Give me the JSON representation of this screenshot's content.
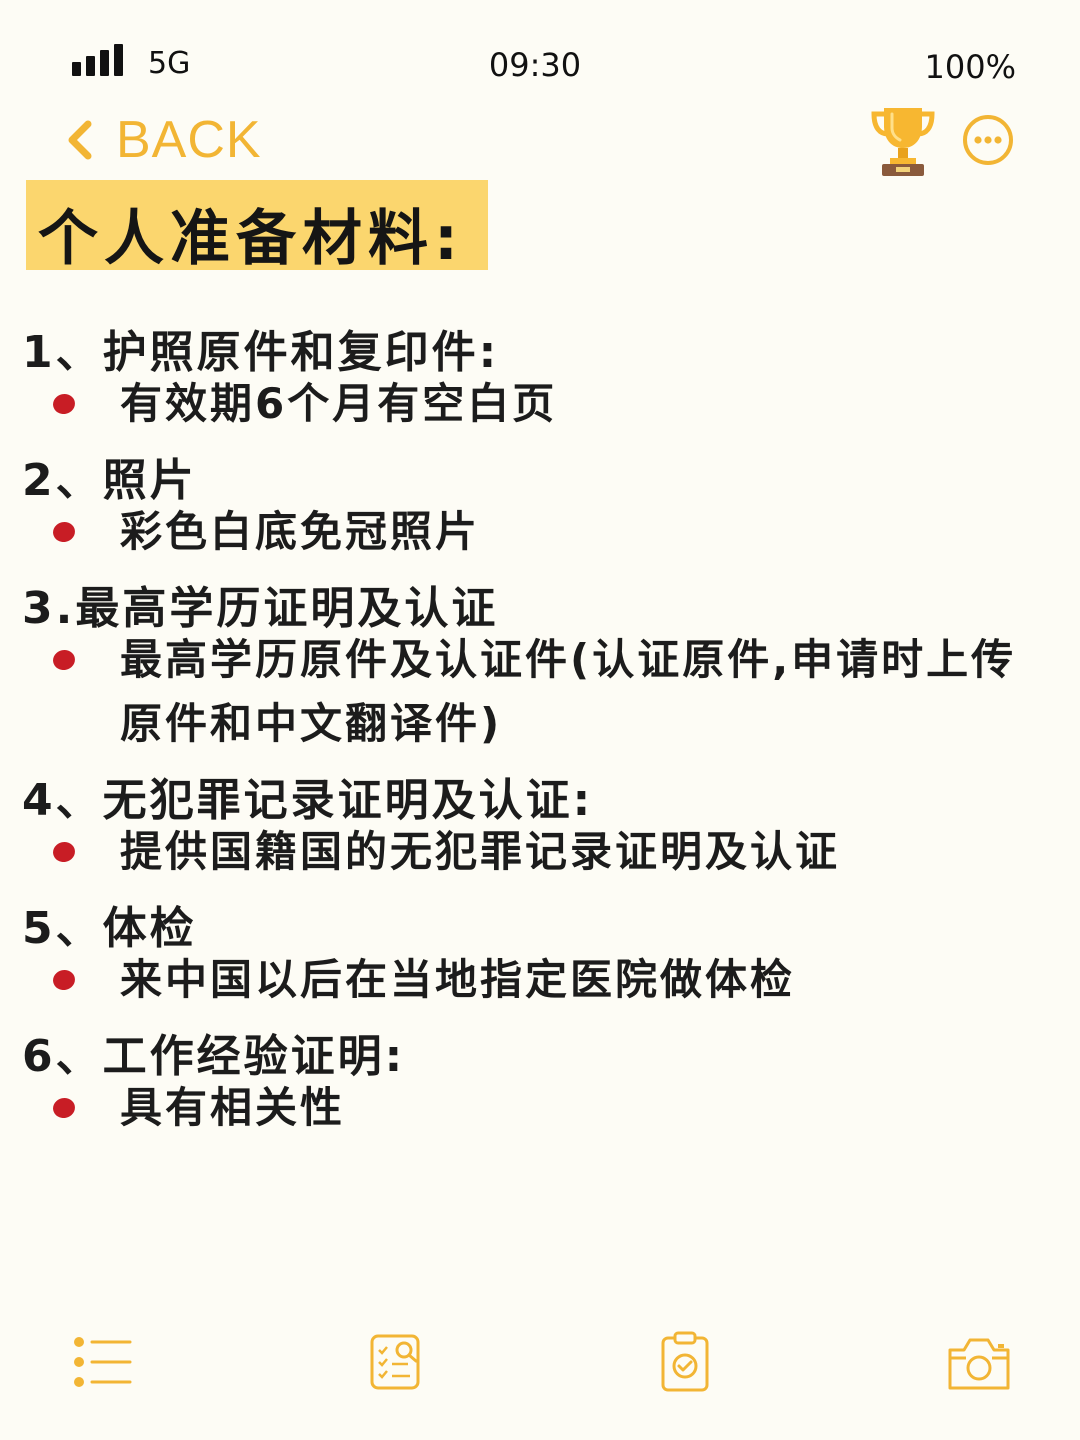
{
  "status_bar": {
    "network": "5G",
    "time": "09:30",
    "battery": "100%",
    "icons": [
      "signal-bars-icon"
    ]
  },
  "nav": {
    "back_label": "BACK",
    "accent_color": "#f2b534",
    "icons": [
      "back-chevron-icon",
      "trophy-icon",
      "more-dots-icon"
    ]
  },
  "title": "个人准备材料:",
  "sections": [
    {
      "heading": "1、护照原件和复印件:",
      "items": [
        "有效期6个月有空白页"
      ]
    },
    {
      "heading": "2、照片",
      "items": [
        "彩色白底免冠照片"
      ]
    },
    {
      "heading": "3.最高学历证明及认证",
      "items": [
        "最高学历原件及认证件(认证原件,申请时上传原件和中文翻译件)"
      ]
    },
    {
      "heading": "4、无犯罪记录证明及认证:",
      "items": [
        "提供国籍国的无犯罪记录证明及认证"
      ]
    },
    {
      "heading": "5、体检",
      "items": [
        "来中国以后在当地指定医院做体检"
      ]
    },
    {
      "heading": "6、工作经验证明:",
      "items": [
        "具有相关性"
      ]
    }
  ],
  "colors": {
    "background": "#fdfcf5",
    "highlight": "#fbd66e",
    "bullet": "#c81d25",
    "icon_accent": "#f2b534"
  },
  "bottom_nav": {
    "icons": [
      "list-icon",
      "checklist-search-icon",
      "clipboard-check-icon",
      "camera-icon"
    ]
  }
}
